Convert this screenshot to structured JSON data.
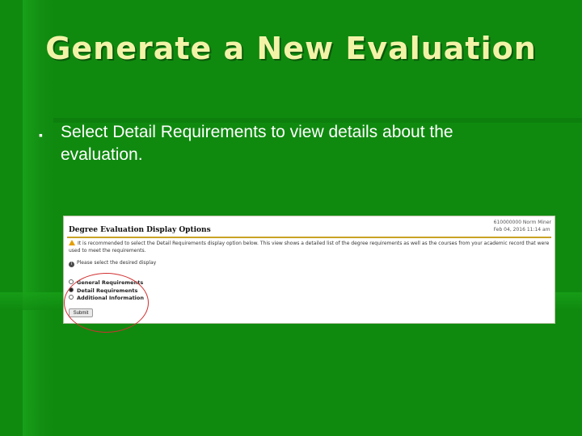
{
  "slide": {
    "title": "Generate a New Evaluation",
    "bullet": "Select Detail Requirements to view details about the evaluation."
  },
  "screenshot": {
    "header": "Degree Evaluation Display Options",
    "meta_line1": "610000000 Norm Miner",
    "meta_line2": "Feb 04, 2016 11:14 am",
    "warning": "It is recommended to select the Detail Requirements display option below. This view shows a detailed list of the degree requirements as well as the courses from your academic record that were used to meet the requirements.",
    "info": "Please select the desired display",
    "options": [
      {
        "label": "General Requirements",
        "selected": false
      },
      {
        "label": "Detail Requirements",
        "selected": true
      },
      {
        "label": "Additional Information",
        "selected": false
      }
    ],
    "submit_label": "Submit"
  },
  "colors": {
    "background": "#0f8a0f",
    "title": "#f3f3a8",
    "highlight_circle": "#d23030"
  }
}
